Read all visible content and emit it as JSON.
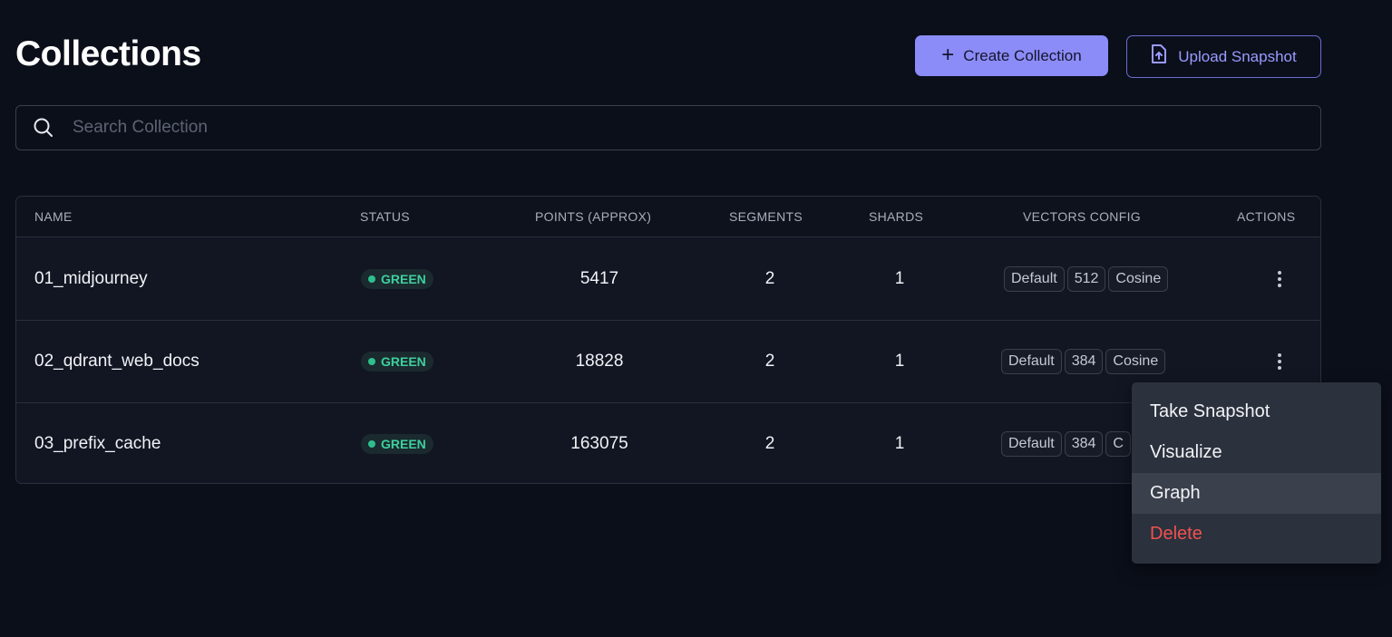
{
  "header": {
    "title": "Collections",
    "create_label": "Create Collection",
    "upload_label": "Upload Snapshot"
  },
  "search": {
    "placeholder": "Search Collection"
  },
  "table": {
    "columns": [
      "NAME",
      "STATUS",
      "POINTS (APPROX)",
      "SEGMENTS",
      "SHARDS",
      "VECTORS CONFIG",
      "ACTIONS"
    ],
    "rows": [
      {
        "name": "01_midjourney",
        "status": "GREEN",
        "points": "5417",
        "segments": "2",
        "shards": "1",
        "vectors": [
          "Default",
          "512",
          "Cosine"
        ]
      },
      {
        "name": "02_qdrant_web_docs",
        "status": "GREEN",
        "points": "18828",
        "segments": "2",
        "shards": "1",
        "vectors": [
          "Default",
          "384",
          "Cosine"
        ]
      },
      {
        "name": "03_prefix_cache",
        "status": "GREEN",
        "points": "163075",
        "segments": "2",
        "shards": "1",
        "vectors": [
          "Default",
          "384",
          "C"
        ]
      }
    ]
  },
  "actions_menu": {
    "items": [
      "Take Snapshot",
      "Visualize",
      "Graph",
      "Delete"
    ]
  },
  "colors": {
    "accent": "#8b8cf8",
    "status_green": "#3fcf9e",
    "danger": "#f0524f",
    "background": "#0b0f1a"
  }
}
